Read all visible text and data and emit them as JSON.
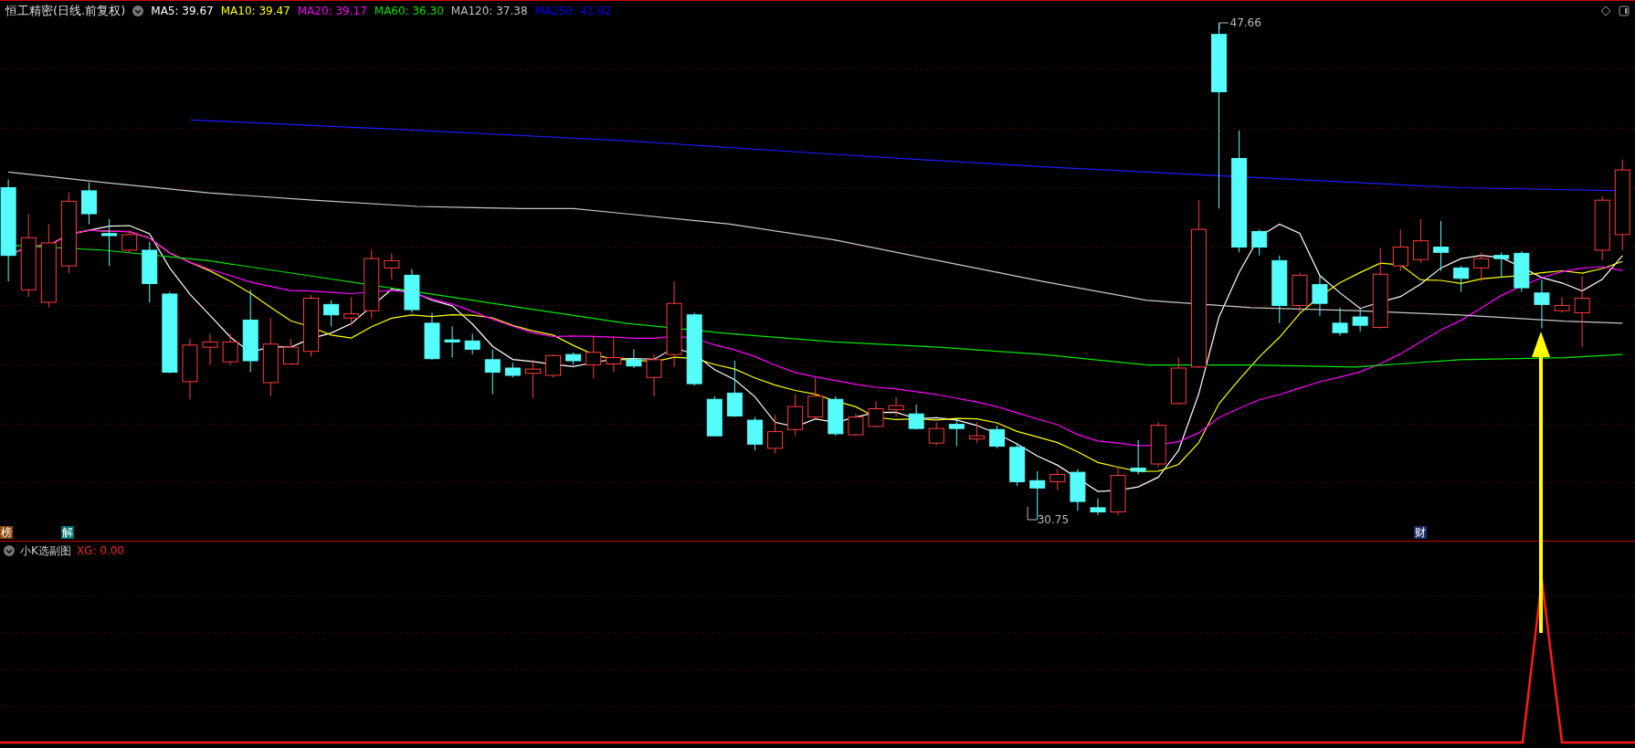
{
  "chart": {
    "title": "恒工精密(日线.前复权)",
    "indicators": [
      {
        "label": "MA5: 39.67",
        "color": "#ffffff"
      },
      {
        "label": "MA10: 39.47",
        "color": "#ffff00"
      },
      {
        "label": "MA20: 39.17",
        "color": "#ff00ff"
      },
      {
        "label": "MA60: 36.30",
        "color": "#00e600"
      },
      {
        "label": "MA120: 37.38",
        "color": "#c0c0c0"
      },
      {
        "label": "MA250: 41.92",
        "color": "#0000ff"
      }
    ],
    "high_label": "47.66",
    "low_label": "30.75",
    "markers": [
      {
        "text": "榜",
        "color": "#8b4a0b"
      },
      {
        "text": "解",
        "color": "#007474"
      },
      {
        "text": "财",
        "color": "#1c2f6b"
      }
    ]
  },
  "subchart": {
    "title": "小K选副图",
    "value": "XG: 0.00"
  }
}
